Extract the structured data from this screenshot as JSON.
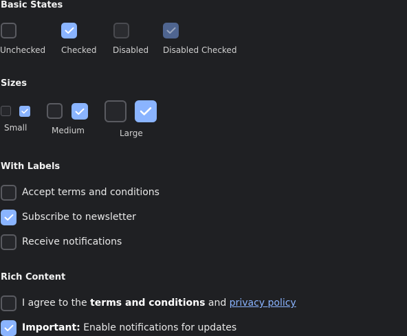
{
  "colors": {
    "background": "#1f2023",
    "accent": "#8ab4ff",
    "disabled_checked": "#4f6590",
    "border": "#5a5b61"
  },
  "sections": {
    "basic": {
      "title": "Basic States",
      "items": [
        {
          "caption": "Unchecked",
          "state": "unchecked"
        },
        {
          "caption": "Checked",
          "state": "checked"
        },
        {
          "caption": "Disabled",
          "state": "disabled"
        },
        {
          "caption": "Disabled Checked",
          "state": "disabled-checked"
        }
      ]
    },
    "sizes": {
      "title": "Sizes",
      "small": "Small",
      "medium": "Medium",
      "large": "Large"
    },
    "labels": {
      "title": "With Labels",
      "items": [
        {
          "text": "Accept terms and conditions",
          "checked": false
        },
        {
          "text": "Subscribe to newsletter",
          "checked": true
        },
        {
          "text": "Receive notifications",
          "checked": false
        }
      ]
    },
    "rich": {
      "title": "Rich Content",
      "item1": {
        "prefix": "I agree to the ",
        "bold": "terms and conditions",
        "middle": " and ",
        "link": "privacy policy",
        "checked": false
      },
      "item2": {
        "bold": "Important:",
        "rest": " Enable notifications for updates",
        "checked": true
      }
    }
  }
}
